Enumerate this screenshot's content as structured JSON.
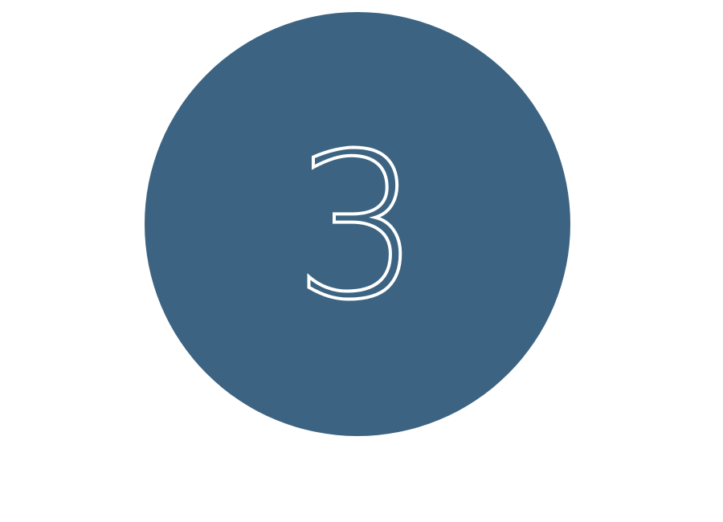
{
  "step": {
    "number": "3",
    "circle_color": "#3c6482",
    "number_color": "#ffffff"
  }
}
